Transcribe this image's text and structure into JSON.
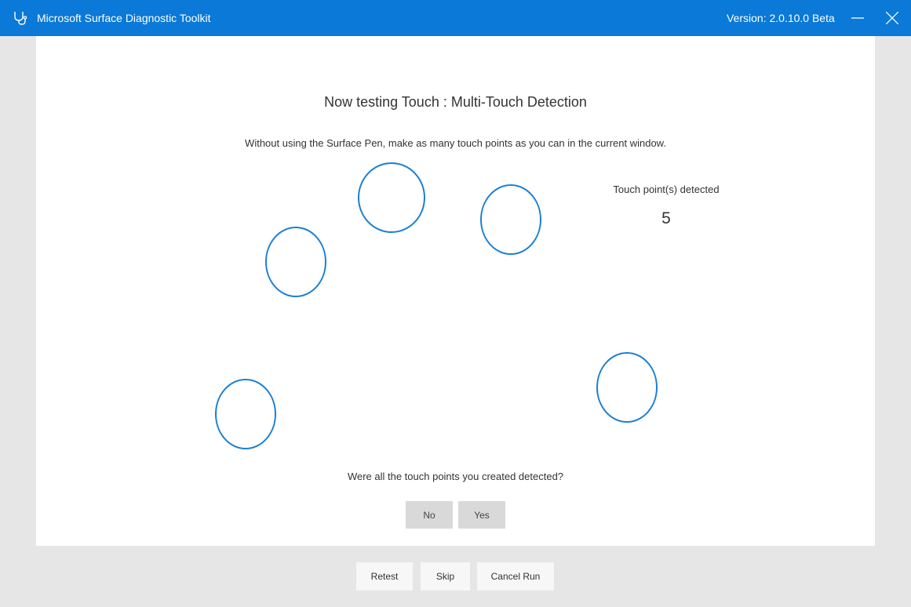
{
  "titlebar": {
    "app_title": "Microsoft Surface Diagnostic Toolkit",
    "version": "Version: 2.0.10.0 Beta",
    "app_icon": "stethoscope-icon",
    "minimize_icon": "minimize-icon",
    "close_icon": "close-icon"
  },
  "test": {
    "heading": "Now testing Touch : Multi-Touch Detection",
    "instruction": "Without using the Surface Pen, make as many touch points as you can in the current window.",
    "detected_label": "Touch point(s) detected",
    "detected_count": "5",
    "question": "Were all the touch points you created detected?",
    "no_label": "No",
    "yes_label": "Yes"
  },
  "footer": {
    "retest_label": "Retest",
    "skip_label": "Skip",
    "cancel_label": "Cancel Run"
  },
  "colors": {
    "titlebar": "#0a79d8",
    "touch_circle": "#1a7fd4",
    "background": "#e6e6e6",
    "panel": "#ffffff"
  }
}
